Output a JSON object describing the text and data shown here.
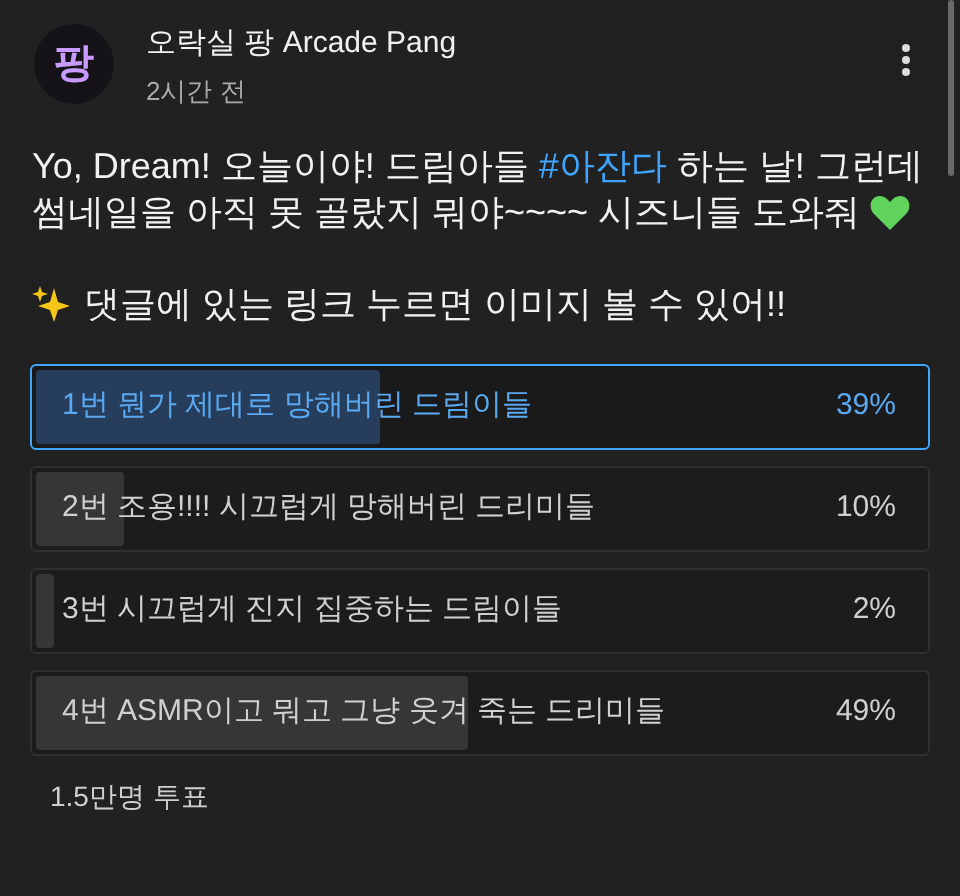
{
  "post": {
    "channel": "오락실 팡 Arcade Pang",
    "avatar_text": "팡",
    "time": "2시간 전",
    "text_before": "Yo, Dream! 오늘이야! 드림아들 ",
    "hashtag": "#아잔다",
    "text_after": " 하는 날! 그런데 썸네일을 아직 못 골랐지 뭐야~~~~ 시즈니들 도와줘",
    "note": "댓글에 있는 링크 누르면 이미지 볼 수 있어!!"
  },
  "poll": {
    "options": [
      {
        "label": "1번 뭔가 제대로 망해버린 드림이들",
        "percent": "39%",
        "level": 0.39,
        "selected": true
      },
      {
        "label": "2번 조용!!!! 시끄럽게 망해버린 드리미들",
        "percent": "10%",
        "level": 0.1,
        "selected": false
      },
      {
        "label": "3번 시끄럽게 진지 집중하는 드림이들",
        "percent": "2%",
        "level": 0.02,
        "selected": false
      },
      {
        "label": "4번 ASMR이고 뭐고 그냥 웃겨 죽는 드리미들",
        "percent": "49%",
        "level": 0.49,
        "selected": false
      }
    ],
    "votes": "1.5만명 투표"
  }
}
